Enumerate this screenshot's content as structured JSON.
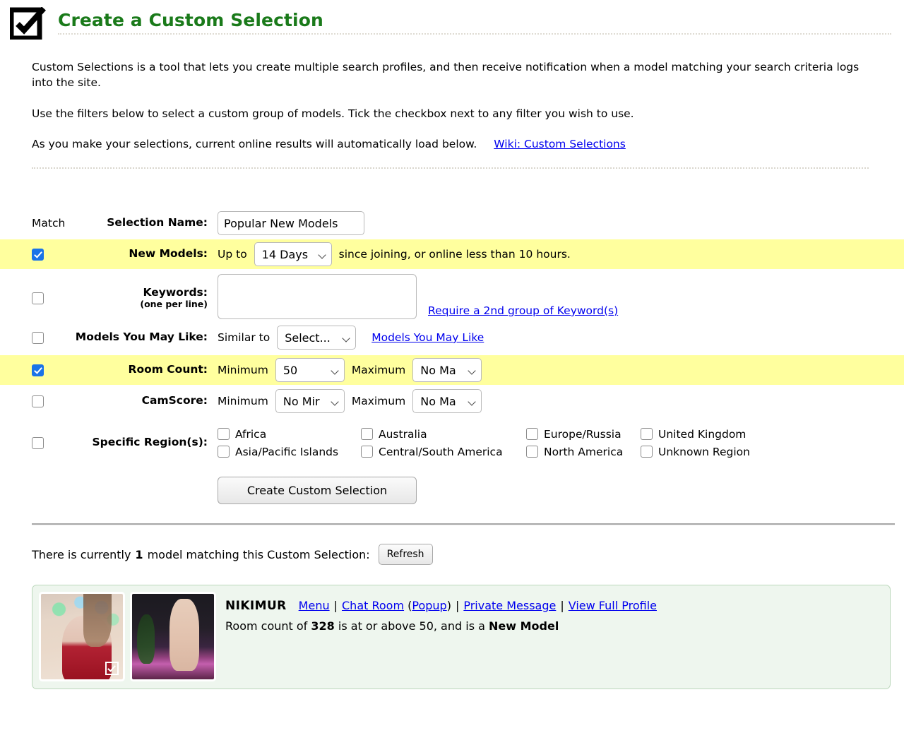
{
  "header": {
    "icon": "checkbox-checked-icon",
    "title": "Create a Custom Selection",
    "title_color": "#1a7a1a"
  },
  "intro": {
    "paragraph1": "Custom Selections is a tool that lets you create multiple search profiles, and then receive notification when a model matching your search criteria logs into the site.",
    "paragraph2": "Use the filters below to select a custom group of models. Tick the checkbox next to any filter you wish to use.",
    "paragraph3": "As you make your selections, current online results will automatically load below.",
    "wiki_link": "Wiki: Custom Selections"
  },
  "form": {
    "match_header": "Match",
    "highlight_color": "#ffff9e",
    "selection_name": {
      "label": "Selection Name:",
      "value": "Popular New Models"
    },
    "new_models": {
      "label": "New Models:",
      "checked": true,
      "prefix": "Up to",
      "days_value": "14 Days",
      "suffix": "since joining, or online less than 10 hours."
    },
    "keywords": {
      "label": "Keywords:",
      "sublabel": "(one per line)",
      "checked": false,
      "value": "",
      "second_group_link": "Require a 2nd group of Keyword(s)"
    },
    "models_you_may_like": {
      "label": "Models You May Like:",
      "checked": false,
      "prefix": "Similar to",
      "select_value": "Select...",
      "link": "Models You May Like"
    },
    "room_count": {
      "label": "Room Count:",
      "checked": true,
      "minimum_label": "Minimum",
      "minimum_value": "50",
      "maximum_label": "Maximum",
      "maximum_value": "No Ma"
    },
    "camscore": {
      "label": "CamScore:",
      "checked": false,
      "minimum_label": "Minimum",
      "minimum_value": "No Mir",
      "maximum_label": "Maximum",
      "maximum_value": "No Ma"
    },
    "specific_regions": {
      "label": "Specific Region(s):",
      "checked": false,
      "options": [
        "Africa",
        "Australia",
        "Europe/Russia",
        "United Kingdom",
        "Asia/Pacific Islands",
        "Central/South America",
        "North America",
        "Unknown Region"
      ]
    },
    "create_button": "Create Custom Selection"
  },
  "results": {
    "summary_prefix": "There is currently",
    "summary_count": "1",
    "summary_suffix": "model matching this Custom Selection:",
    "refresh_button": "Refresh",
    "model": {
      "name": "NIKIMUR",
      "links": {
        "menu": "Menu",
        "chat_room": "Chat Room",
        "popup": "Popup",
        "private_message": "Private Message",
        "view_full_profile": "View Full Profile"
      },
      "separator": "|",
      "description_prefix": "Room count of",
      "room_count": "328",
      "description_middle": "is at or above 50, and is a",
      "badge": "New Model"
    }
  }
}
